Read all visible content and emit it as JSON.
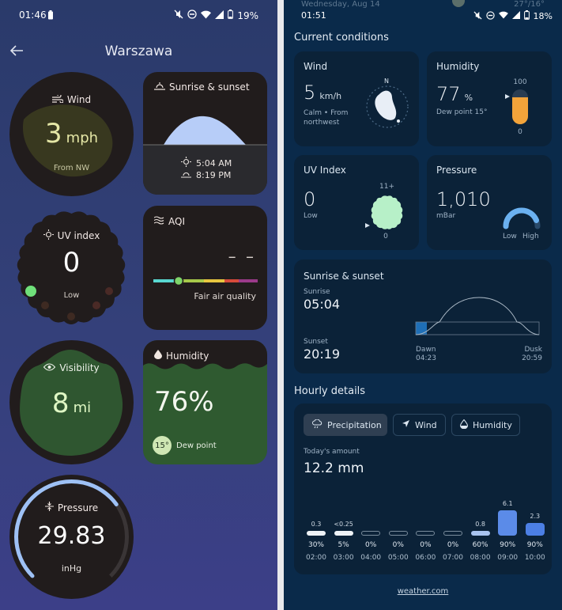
{
  "left": {
    "status": {
      "time": "01:46",
      "battery": "19%"
    },
    "header": {
      "title": "Warszawa"
    },
    "wind": {
      "label": "Wind",
      "value": "3",
      "unit": "mph",
      "direction": "From NW"
    },
    "sun": {
      "label": "Sunrise & sunset",
      "sunrise": "5:04 AM",
      "sunset": "8:19 PM"
    },
    "uv": {
      "label": "UV index",
      "value": "0",
      "level": "Low"
    },
    "aqi": {
      "label": "AQI",
      "value": "– –",
      "quality": "Fair air quality",
      "marker_fraction": 0.24
    },
    "visibility": {
      "label": "Visibility",
      "value": "8",
      "unit": "mi"
    },
    "humidity": {
      "label": "Humidity",
      "value": "76%",
      "dew_point_value": "15°",
      "dew_point_label": "Dew point"
    },
    "pressure": {
      "label": "Pressure",
      "value": "29.83",
      "unit": "inHg",
      "gauge_fraction": 0.7
    }
  },
  "right": {
    "status": {
      "time": "01:51",
      "battery": "18%",
      "date_peek": "Wednesday, Aug 14",
      "temps_peek": "27°/16°"
    },
    "current_title": "Current conditions",
    "wind": {
      "label": "Wind",
      "value": "5",
      "unit": "km/h",
      "desc": "Calm • From northwest",
      "compass": "N"
    },
    "humidity": {
      "label": "Humidity",
      "value": "77",
      "unit": "%",
      "dew": "Dew point 15°",
      "max": "100",
      "min": "0",
      "fraction": 0.77
    },
    "uv": {
      "label": "UV Index",
      "value": "0",
      "level": "Low",
      "max": "11+",
      "min": "0"
    },
    "pressure": {
      "label": "Pressure",
      "value": "1,010",
      "unit": "mBar",
      "low": "Low",
      "high": "High"
    },
    "sun": {
      "label": "Sunrise & sunset",
      "sunrise_label": "Sunrise",
      "sunrise": "05:04",
      "sunset_label": "Sunset",
      "sunset": "20:19",
      "dawn_label": "Dawn",
      "dawn": "04:23",
      "dusk_label": "Dusk",
      "dusk": "20:59"
    },
    "hourly": {
      "title": "Hourly details",
      "tabs": [
        "Precipitation",
        "Wind",
        "Humidity"
      ],
      "amount_label": "Today's amount",
      "amount": "12.2 mm",
      "hours": [
        {
          "time": "02:00",
          "prob": "30%",
          "amount": "0.3",
          "h": 0.1,
          "fill": "#eef2f6"
        },
        {
          "time": "03:00",
          "prob": "5%",
          "amount": "<0.25",
          "h": 0.08,
          "fill": "#eef2f6"
        },
        {
          "time": "04:00",
          "prob": "0%",
          "amount": "",
          "h": 0.06,
          "fill": "none"
        },
        {
          "time": "05:00",
          "prob": "0%",
          "amount": "",
          "h": 0.06,
          "fill": "none"
        },
        {
          "time": "06:00",
          "prob": "0%",
          "amount": "",
          "h": 0.06,
          "fill": "none"
        },
        {
          "time": "07:00",
          "prob": "0%",
          "amount": "",
          "h": 0.06,
          "fill": "none"
        },
        {
          "time": "08:00",
          "prob": "60%",
          "amount": "0.8",
          "h": 0.12,
          "fill": "#a9c4f0"
        },
        {
          "time": "09:00",
          "prob": "90%",
          "amount": "6.1",
          "h": 1.0,
          "fill": "#5b8be8"
        },
        {
          "time": "10:00",
          "prob": "90%",
          "amount": "2.3",
          "h": 0.5,
          "fill": "#4c7fe4"
        }
      ]
    },
    "footer": "weather.com"
  }
}
